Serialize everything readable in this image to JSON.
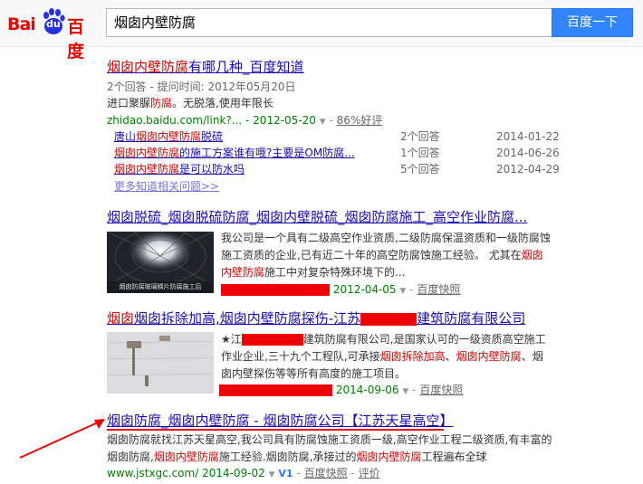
{
  "logo": {
    "part1": "Bai",
    "part2": "du",
    "part3": "百度"
  },
  "search": {
    "query": "烟囱内壁防腐",
    "button": "百度一下"
  },
  "r1": {
    "title_a": "烟囱内壁防腐",
    "title_b": "有哪几种_百度知道",
    "meta": "2个回答 - 提问时间: 2012年05月20日",
    "abs_a": "进口聚脲",
    "abs_b": "防腐",
    "abs_c": "。无脱落,使用年限长",
    "url": "zhidao.baidu.com/link?...",
    "date": "- 2012-05-20",
    "rate": "86%好评",
    "subs": [
      {
        "a": "唐山",
        "b": "烟囱内壁防腐",
        "c": "脱硫",
        "count": "2个回答",
        "date": "2014-01-22"
      },
      {
        "a": "",
        "b": "烟囱内壁防腐",
        "c": "的施工方案谁有哦?主要是OM防腐...",
        "count": "1个回答",
        "date": "2014-06-26"
      },
      {
        "a": "",
        "b": "烟囱内壁防腐",
        "c": "是可以防水吗",
        "count": "5个回答",
        "date": "2012-04-29"
      }
    ],
    "more": "更多知道相关问题>>"
  },
  "r2": {
    "title": "烟囱脱硫_烟囱脱硫防腐_烟囱内壁脱硫_烟囱防腐施工_高空作业防腐...",
    "thumb_caption": "烟囱防腐玻璃鳞片防腐施工后",
    "abs1": "我公司是一个具有二级高空作业资质,二级防腐保温资质和一级防腐蚀",
    "abs2": "施工资质的企业,已有近二十年的高空防腐蚀施工经验。 尤其在",
    "abs2_em": "烟囱",
    "abs3_em": "内壁防腐",
    "abs3": "施工中对复杂特殊环境下的...",
    "date": "2012-04-05",
    "snap": "百度快照"
  },
  "r3": {
    "title_a": "烟囱拆除加高,烟囱内壁防腐探伤-江苏",
    "title_b": "建筑防腐有限公司",
    "abs1_a": "★江",
    "abs1_b": "建筑防腐有限公司,是国家认可的一级资质高空施工",
    "abs2_a": "作业企业,三十九个工程队,可承接",
    "abs2_em1": "烟囱拆除加高",
    "abs2_b": "、",
    "abs2_em2": "烟囱内壁防腐",
    "abs2_c": "、烟",
    "abs3": "囱内壁探伤等等所有高度的施工项目。",
    "date": "2014-09-06",
    "snap": "百度快照"
  },
  "r4": {
    "title": "烟囱防腐_烟囱内壁防腐 - 烟囱防腐公司【江苏天星高空】",
    "abs1": "烟囱防腐就找江苏天星高空,我公司具有防腐蚀施工资质一级,高空作业工程二级资质,有丰富的",
    "abs2_a": "烟囱防腐,",
    "abs2_em1": "烟囱内壁防腐",
    "abs2_b": "施工经验.烟囱防腐,承接过的",
    "abs2_em2": "烟囱内壁防腐",
    "abs2_c": "工程遍布全球",
    "url": "www.jstxgc.com/ 2014-09-02",
    "v": "V1",
    "snap": "百度快照",
    "eval": "评价"
  },
  "colors": {
    "link": "#1a0dab",
    "em": "#cc0000",
    "url": "#008000",
    "brand": "#e10601",
    "button": "#3385ff",
    "annotation": "#e00000"
  }
}
